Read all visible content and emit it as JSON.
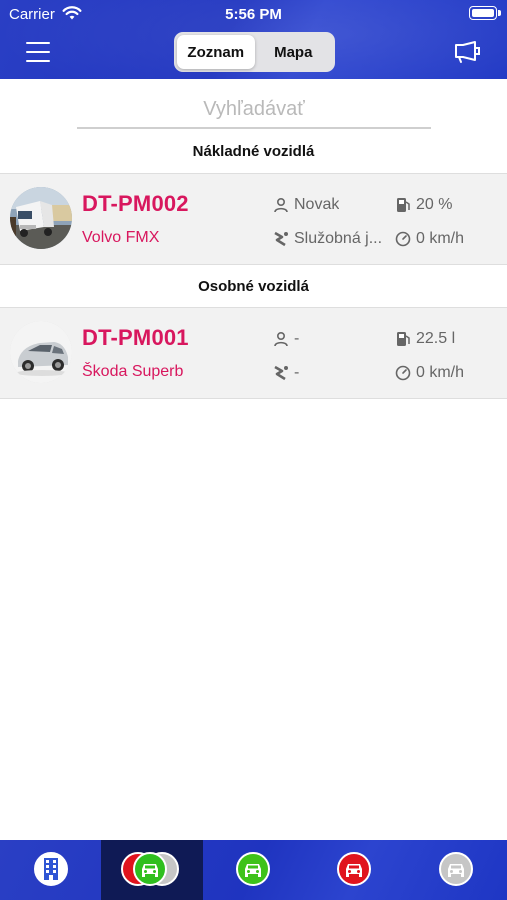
{
  "status_bar": {
    "carrier": "Carrier",
    "time": "5:56 PM"
  },
  "nav": {
    "segments": [
      "Zoznam",
      "Mapa"
    ],
    "active_segment": "Zoznam"
  },
  "search": {
    "placeholder": "Vyhľadávať",
    "value": ""
  },
  "sections": [
    {
      "title": "Nákladné vozidlá",
      "vehicles": [
        {
          "plate": "DT-PM002",
          "model": "Volvo FMX",
          "driver": "Novak",
          "trip_type": "Služobná j...",
          "fuel": "20 %",
          "speed": "0 km/h",
          "image": "truck"
        }
      ]
    },
    {
      "title": "Osobné vozidlá",
      "vehicles": [
        {
          "plate": "DT-PM001",
          "model": "Škoda Superb",
          "driver": "-",
          "trip_type": "-",
          "fuel": "22.5 l",
          "speed": "0 km/h",
          "image": "car"
        }
      ]
    }
  ],
  "tabbar": {
    "tabs": [
      {
        "icon": "building-icon",
        "color": "#2f55d4"
      },
      {
        "icon": "car-stack-icon",
        "color": "#2fbf1f"
      },
      {
        "icon": "car-icon",
        "color": "#3ec21a"
      },
      {
        "icon": "car-icon",
        "color": "#e0141e"
      },
      {
        "icon": "car-icon",
        "color": "#c6c6c6"
      }
    ],
    "active_index": 1
  },
  "colors": {
    "accent": "#d8175e",
    "header": "#1f34c0"
  }
}
